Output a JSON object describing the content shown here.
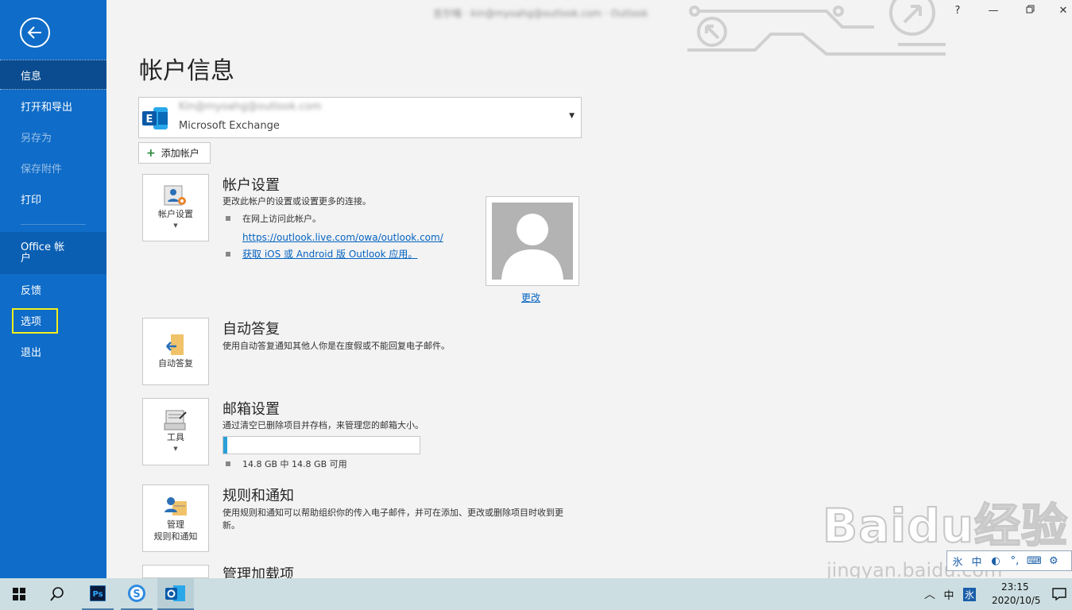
{
  "window": {
    "title_blurred": "吉尔喵 · kin@myoahg@outlook.com · Outlook",
    "help_label": "?",
    "minimize_label": "—",
    "close_label": "✕"
  },
  "sidebar": {
    "items": [
      {
        "label": "信息",
        "state": "active"
      },
      {
        "label": "打开和导出",
        "state": "normal"
      },
      {
        "label": "另存为",
        "state": "disabled"
      },
      {
        "label": "保存附件",
        "state": "disabled"
      },
      {
        "label": "打印",
        "state": "normal"
      },
      {
        "label": "Office 帐户",
        "state": "office"
      },
      {
        "label": "反馈",
        "state": "normal"
      },
      {
        "label": "选项",
        "state": "highlighted"
      },
      {
        "label": "退出",
        "state": "normal"
      }
    ]
  },
  "main": {
    "title": "帐户信息",
    "account": {
      "email_blurred": "Kin@myoahg@outlook.com",
      "type": "Microsoft Exchange"
    },
    "add_account_label": "添加帐户",
    "account_settings": {
      "tile_label": "帐户设置",
      "title": "帐户设置",
      "description": "更改此帐户的设置或设置更多的连接。",
      "bullet_text": "在网上访问此帐户。",
      "web_link": "https://outlook.live.com/owa/outlook.com/",
      "mobile_link": "获取 iOS 或 Android 版 Outlook 应用。",
      "change_photo_link": "更改"
    },
    "auto_reply": {
      "tile_label": "自动答复",
      "title": "自动答复",
      "description": "使用自动答复通知其他人你是在度假或不能回复电子邮件。"
    },
    "mailbox": {
      "tile_label": "工具",
      "title": "邮箱设置",
      "description": "通过清空已删除项目并存档，来管理您的邮箱大小。",
      "storage_text": "14.8 GB 中 14.8 GB 可用",
      "storage_used_fraction": 0.02
    },
    "rules": {
      "tile_label_line1": "管理",
      "tile_label_line2": "规则和通知",
      "title": "规则和通知",
      "description": "使用规则和通知可以帮助组织你的传入电子邮件，并可在添加、更改或删除项目时收到更新。"
    },
    "addins": {
      "title": "管理加载项"
    }
  },
  "watermark": {
    "text": "Baidu经验",
    "url": "jingyan.baidu.com"
  },
  "ime": {
    "items": [
      "氷",
      "中",
      "◐",
      "°,",
      "⌨",
      "⚙"
    ]
  },
  "taskbar": {
    "tray_lang": "中",
    "tray_ime": "氷",
    "time": "23:15",
    "date": "2020/10/5"
  },
  "colors": {
    "sidebar": "#0f6cc8",
    "sidebar_active": "#0a4c8f",
    "highlight_box": "#f3ee1c",
    "link": "#0563c1",
    "taskbar": "#ccdee2"
  }
}
